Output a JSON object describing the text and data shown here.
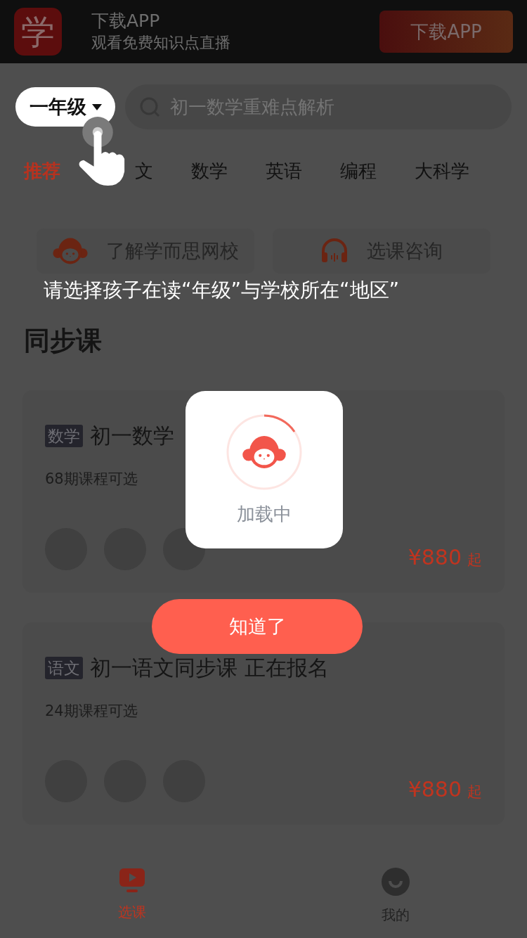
{
  "banner": {
    "logo": "学",
    "title": "下载APP",
    "subtitle": "观看免费知识点直播",
    "button": "下载APP"
  },
  "grade_selector": {
    "label": "一年级"
  },
  "search": {
    "placeholder": "初一数学重难点解析"
  },
  "tabs": [
    {
      "label": "推荐",
      "selected": true
    },
    {
      "label": "文",
      "selected": false
    },
    {
      "label": "数学",
      "selected": false
    },
    {
      "label": "英语",
      "selected": false
    },
    {
      "label": "编程",
      "selected": false
    },
    {
      "label": "大科学",
      "selected": false
    }
  ],
  "shortcuts": [
    {
      "kind": "monkey",
      "label": "了解学而思网校"
    },
    {
      "kind": "headset",
      "label": "选课咨询"
    }
  ],
  "guide": {
    "hint": "请选择孩子在读“年级”与学校所在“地区”",
    "button": "知道了"
  },
  "section_title": "同步课",
  "courses": [
    {
      "tag": "数学",
      "title": "初一数学",
      "subtitle": "68期课程可选",
      "price": "¥880",
      "price_suffix": "起"
    },
    {
      "tag": "语文",
      "title": "初一语文同步课 正在报名",
      "subtitle": "24期课程可选",
      "price": "¥880",
      "price_suffix": "起"
    }
  ],
  "loading": {
    "label": "加载中"
  },
  "bottom_nav": [
    {
      "kind": "courses",
      "label": "选课",
      "selected": true
    },
    {
      "kind": "profile",
      "label": "我的",
      "selected": false
    }
  ]
}
